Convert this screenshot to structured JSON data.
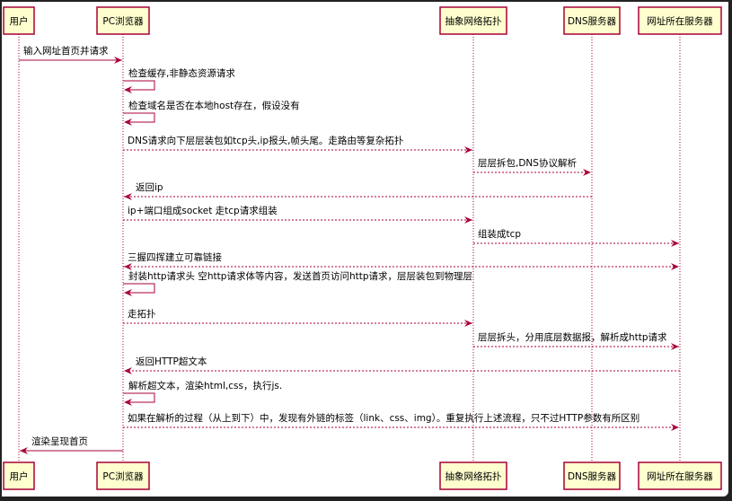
{
  "participants": [
    "用户",
    "PC浏览器",
    "抽象网络拓扑",
    "DNS服务器",
    "网址所在服务器"
  ],
  "colors": {
    "line": "#a80036",
    "box_fill": "#fefece",
    "background": "#ffffff"
  },
  "messages": [
    {
      "from": 0,
      "to": 1,
      "style": "solid",
      "label": "输入网址首页并请求"
    },
    {
      "from": 1,
      "to": 1,
      "style": "solid",
      "label": "检查缓存,非静态资源请求"
    },
    {
      "from": 1,
      "to": 1,
      "style": "solid",
      "label": "检查域名是否在本地host存在，假设没有"
    },
    {
      "from": 1,
      "to": 2,
      "style": "dashed",
      "label": "DNS请求向下层层装包如tcp头,ip报头,帧头尾。走路由等复杂拓扑"
    },
    {
      "from": 2,
      "to": 3,
      "style": "dashed",
      "label": "层层拆包,DNS协议解析"
    },
    {
      "from": 3,
      "to": 1,
      "style": "dashed",
      "label": "返回ip"
    },
    {
      "from": 1,
      "to": 2,
      "style": "dashed",
      "label": "ip+端口组成socket 走tcp请求组装"
    },
    {
      "from": 2,
      "to": 4,
      "style": "dashed",
      "label": "组装成tcp"
    },
    {
      "from": 1,
      "to": 4,
      "style": "dashed-both",
      "label": "三握四挥建立可靠链接"
    },
    {
      "from": 1,
      "to": 1,
      "style": "solid",
      "label": "封装http请求头 空http请求体等内容，发送首页访问http请求，层层装包到物理层"
    },
    {
      "from": 1,
      "to": 2,
      "style": "dashed",
      "label": "走拓扑"
    },
    {
      "from": 2,
      "to": 4,
      "style": "dashed",
      "label": "层层拆头，分用底层数据报，解析成http请求"
    },
    {
      "from": 4,
      "to": 1,
      "style": "dashed",
      "label": "返回HTTP超文本"
    },
    {
      "from": 1,
      "to": 1,
      "style": "solid",
      "label": "解析超文本，渲染html,css，执行js."
    },
    {
      "from": 1,
      "to": 4,
      "style": "dashed",
      "label": "如果在解析的过程（从上到下）中，发现有外链的标签（link、css、img）。重复执行上述流程，只不过HTTP参数有所区别"
    },
    {
      "from": 1,
      "to": 0,
      "style": "solid",
      "label": "渲染呈现首页"
    }
  ]
}
